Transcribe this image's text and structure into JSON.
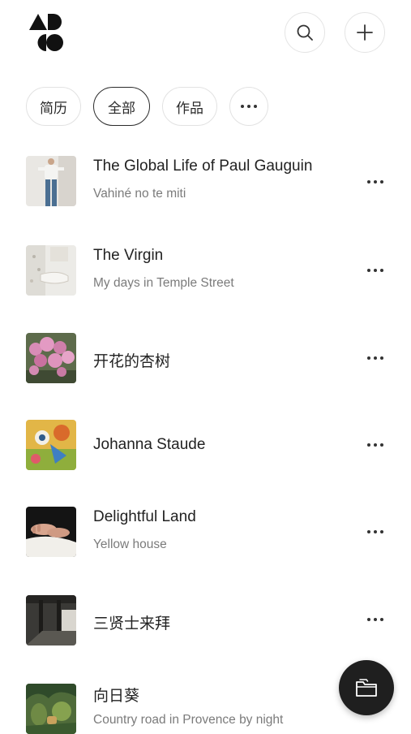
{
  "brand": {
    "logo_icon": "ad-co-logo-icon"
  },
  "header": {
    "search_icon": "search-icon",
    "add_icon": "plus-icon"
  },
  "filters": [
    {
      "label": "简历",
      "active": false
    },
    {
      "label": "全部",
      "active": true
    },
    {
      "label": "作品",
      "active": false
    }
  ],
  "filters_more_icon": "more-dots-icon",
  "items": [
    {
      "title": "The Global Life of Paul Gauguin",
      "subtitle": "Vahiné no te miti",
      "thumb": "figure-artwork"
    },
    {
      "title": "The Virgin",
      "subtitle": "My days in Temple Street",
      "thumb": "sketch-artwork"
    },
    {
      "title": "开花的杏树",
      "subtitle": "",
      "thumb": "pink-blossom-artwork"
    },
    {
      "title": "Johanna Staude",
      "subtitle": "",
      "thumb": "colorful-still-life-artwork"
    },
    {
      "title": "Delightful Land",
      "subtitle": "Yellow house",
      "thumb": "hands-artwork"
    },
    {
      "title": "三贤士来拜",
      "subtitle": "",
      "thumb": "interior-artwork"
    },
    {
      "title": "向日葵",
      "subtitle": "Country road in Provence by night",
      "thumb": "jungle-artwork"
    }
  ],
  "fab": {
    "icon": "folder-icon"
  },
  "colors": {
    "text": "#222222",
    "subtext": "#7b7b7b",
    "border": "#e2e2e2",
    "fab": "#1f1f1f"
  }
}
